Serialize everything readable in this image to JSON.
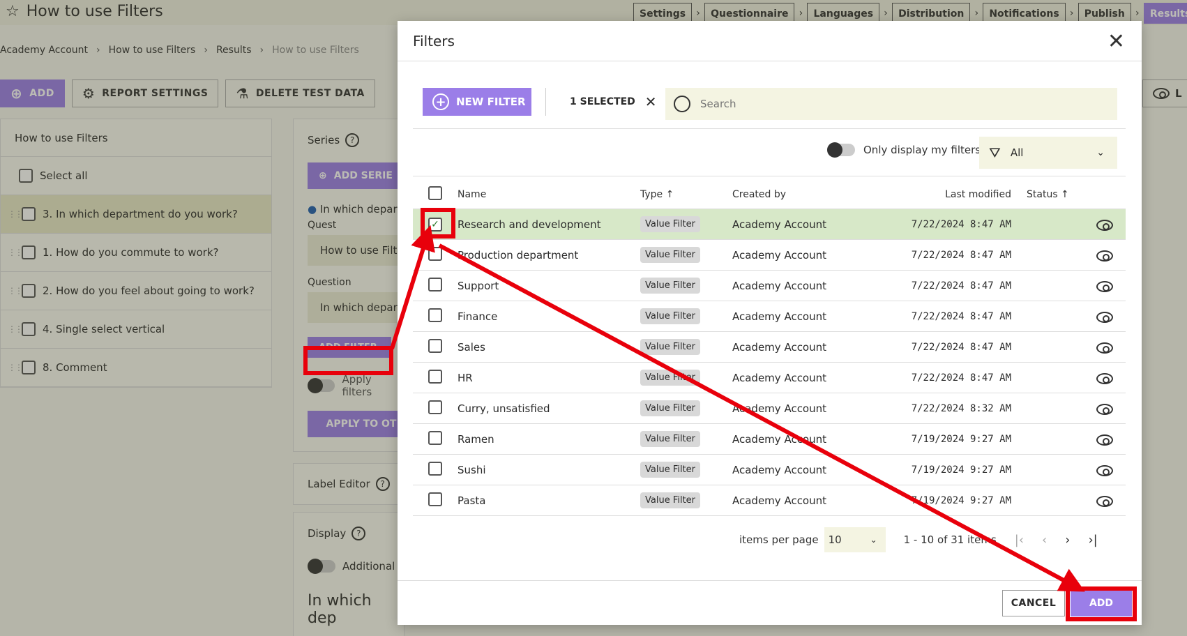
{
  "app": {
    "title": "How to use Filters",
    "steps": [
      {
        "label": "Settings"
      },
      {
        "label": "Questionnaire"
      },
      {
        "label": "Languages"
      },
      {
        "label": "Distribution"
      },
      {
        "label": "Notifications"
      },
      {
        "label": "Publish"
      },
      {
        "label": "Results"
      }
    ],
    "active_step": "Results",
    "breadcrumb": [
      "Academy Account",
      "How to use Filters",
      "Results",
      "How to use Filters"
    ],
    "toolbar": {
      "add_label": "ADD",
      "report_settings_label": "REPORT SETTINGS",
      "delete_test_data_label": "DELETE TEST DATA",
      "right_partial_label": "L"
    }
  },
  "left_panel": {
    "header": "How to use Filters",
    "select_all": "Select all",
    "questions": [
      {
        "label": "3.  In which department do you work?",
        "selected": true
      },
      {
        "label": "1.  How do you commute to work?",
        "selected": false
      },
      {
        "label": "2.  How do you feel about going to work?",
        "selected": false
      },
      {
        "label": "4.  Single select vertical",
        "selected": false
      },
      {
        "label": "8.  Comment",
        "selected": false
      }
    ]
  },
  "mid_panel": {
    "series_label": "Series",
    "add_series_label": "ADD SERIE",
    "series_item": "In which depart",
    "quest_label": "Quest",
    "quest_value": "How to use Filt",
    "question_label": "Question",
    "question_value": "In which depar",
    "add_filter_label": "ADD FILTER",
    "apply_filters_label": "Apply filters",
    "apply_to_other_label": "APPLY TO OT",
    "label_editor_label": "Label Editor",
    "display_label": "Display",
    "additional_label": "Additional l",
    "heading_partial": "In which dep"
  },
  "modal": {
    "title": "Filters",
    "new_filter_label": "NEW FILTER",
    "selected_label": "1 SELECTED",
    "search_placeholder": "Search",
    "only_mine_label": "Only display my filters",
    "filter_dropdown_value": "All",
    "columns": {
      "name": "Name",
      "type": "Type ↑",
      "created_by": "Created by",
      "last_modified": "Last modified",
      "status": "Status ↑"
    },
    "rows": [
      {
        "name": "Research and development",
        "type": "Value Filter",
        "created_by": "Academy Account",
        "modified": "7/22/2024 8:47 AM",
        "checked": true
      },
      {
        "name": "Production department",
        "type": "Value Filter",
        "created_by": "Academy Account",
        "modified": "7/22/2024 8:47 AM",
        "checked": false
      },
      {
        "name": "Support",
        "type": "Value Filter",
        "created_by": "Academy Account",
        "modified": "7/22/2024 8:47 AM",
        "checked": false
      },
      {
        "name": "Finance",
        "type": "Value Filter",
        "created_by": "Academy Account",
        "modified": "7/22/2024 8:47 AM",
        "checked": false
      },
      {
        "name": "Sales",
        "type": "Value Filter",
        "created_by": "Academy Account",
        "modified": "7/22/2024 8:47 AM",
        "checked": false
      },
      {
        "name": "HR",
        "type": "Value Filter",
        "created_by": "Academy Account",
        "modified": "7/22/2024 8:47 AM",
        "checked": false
      },
      {
        "name": "Curry, unsatisfied",
        "type": "Value Filter",
        "created_by": "Academy Account",
        "modified": "7/22/2024 8:32 AM",
        "checked": false
      },
      {
        "name": "Ramen",
        "type": "Value Filter",
        "created_by": "Academy Account",
        "modified": "7/19/2024 9:27 AM",
        "checked": false
      },
      {
        "name": "Sushi",
        "type": "Value Filter",
        "created_by": "Academy Account",
        "modified": "7/19/2024 9:27 AM",
        "checked": false
      },
      {
        "name": "Pasta",
        "type": "Value Filter",
        "created_by": "Academy Account",
        "modified": "7/19/2024 9:27 AM",
        "checked": false
      }
    ],
    "pager": {
      "items_per_page_label": "items per page",
      "items_per_page_value": "10",
      "range_label": "1 - 10 of 31 items"
    },
    "cancel_label": "CANCEL",
    "add_label": "ADD"
  },
  "colors": {
    "accent": "#9b7ee8",
    "annotation": "#e8000b",
    "selected_row": "#d7e8c8"
  }
}
